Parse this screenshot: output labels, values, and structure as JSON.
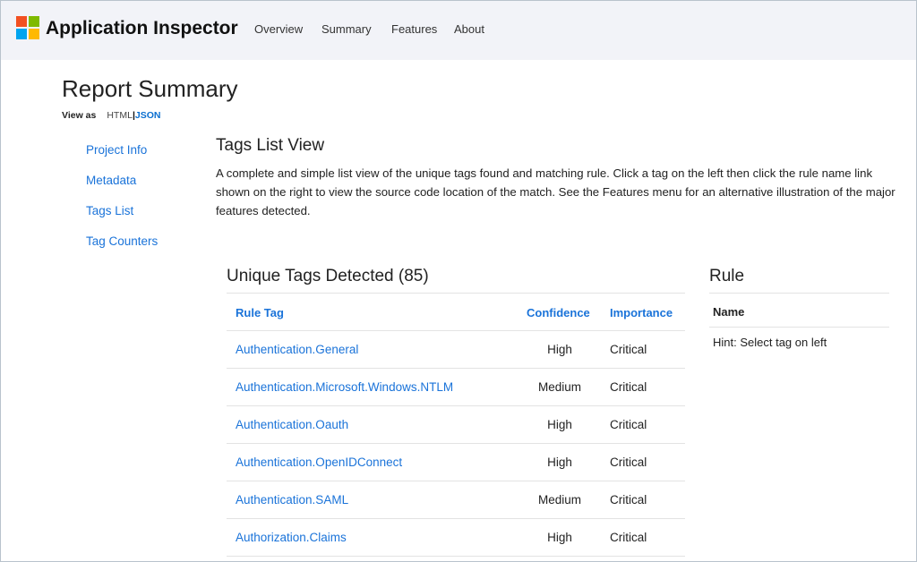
{
  "brand": {
    "name": "Application Inspector"
  },
  "nav": {
    "items": [
      "Overview",
      "Summary",
      "Features",
      "About"
    ]
  },
  "page": {
    "title": "Report Summary",
    "view_as": {
      "label": "View as",
      "html": "HTML",
      "separator": "|",
      "json": "JSON"
    }
  },
  "sidebar": {
    "items": [
      "Project Info",
      "Metadata",
      "Tags List",
      "Tag Counters"
    ]
  },
  "section": {
    "title": "Tags List View",
    "description": "A complete and simple list view of the unique tags found and matching rule. Click a tag on the left then click the rule name link shown on the right to view the source code location of the match. See the Features menu for an alternative illustration of the major features detected."
  },
  "tags_table": {
    "heading": "Unique Tags Detected (85)",
    "columns": {
      "tag": "Rule Tag",
      "confidence": "Confidence",
      "importance": "Importance"
    },
    "rows": [
      {
        "tag": "Authentication.General",
        "confidence": "High",
        "importance": "Critical"
      },
      {
        "tag": "Authentication.Microsoft.Windows.NTLM",
        "confidence": "Medium",
        "importance": "Critical"
      },
      {
        "tag": "Authentication.Oauth",
        "confidence": "High",
        "importance": "Critical"
      },
      {
        "tag": "Authentication.OpenIDConnect",
        "confidence": "High",
        "importance": "Critical"
      },
      {
        "tag": "Authentication.SAML",
        "confidence": "Medium",
        "importance": "Critical"
      },
      {
        "tag": "Authorization.Claims",
        "confidence": "High",
        "importance": "Critical"
      }
    ]
  },
  "rule_panel": {
    "heading": "Rule",
    "name_label": "Name",
    "hint": "Hint: Select tag on left"
  },
  "colors": {
    "accent": "#1a73d9",
    "navbar_bg": "#f2f3f8",
    "logo": [
      "#f25022",
      "#7fba00",
      "#00a4ef",
      "#ffb900"
    ]
  }
}
